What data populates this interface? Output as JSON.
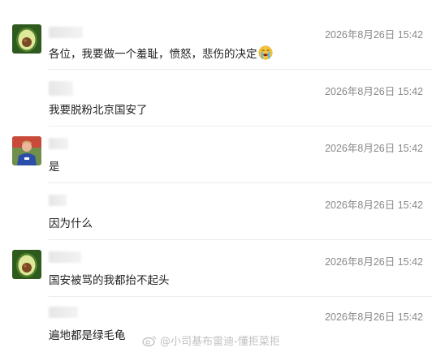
{
  "comments": [
    {
      "time": "2026年8月26日 15:42",
      "text": "各位，我要做一个羞耻，愤怒，悲伤的决定",
      "emoji": "loudly-crying-face-icon",
      "avatar": "avocado-avatar"
    },
    {
      "time": "2026年8月26日 15:42",
      "text": "我要脱粉北京国安了",
      "avatar": "none"
    },
    {
      "time": "2026年8月26日 15:42",
      "text": "是",
      "avatar": "footballer-avatar"
    },
    {
      "time": "2026年8月26日 15:42",
      "text": "因为什么",
      "avatar": "none"
    },
    {
      "time": "2026年8月26日 15:42",
      "text": "国安被骂的我都抬不起头",
      "avatar": "avocado-avatar"
    },
    {
      "time": "2026年8月26日 15:42",
      "text": "遍地都是绿毛龟",
      "avatar": "none"
    }
  ],
  "watermark": {
    "text": "@小司基布雷迪-懂拒菜拒",
    "icon": "weibo-icon"
  },
  "colors": {
    "time": "#888888",
    "text": "#222222",
    "divider": "#ececec"
  }
}
